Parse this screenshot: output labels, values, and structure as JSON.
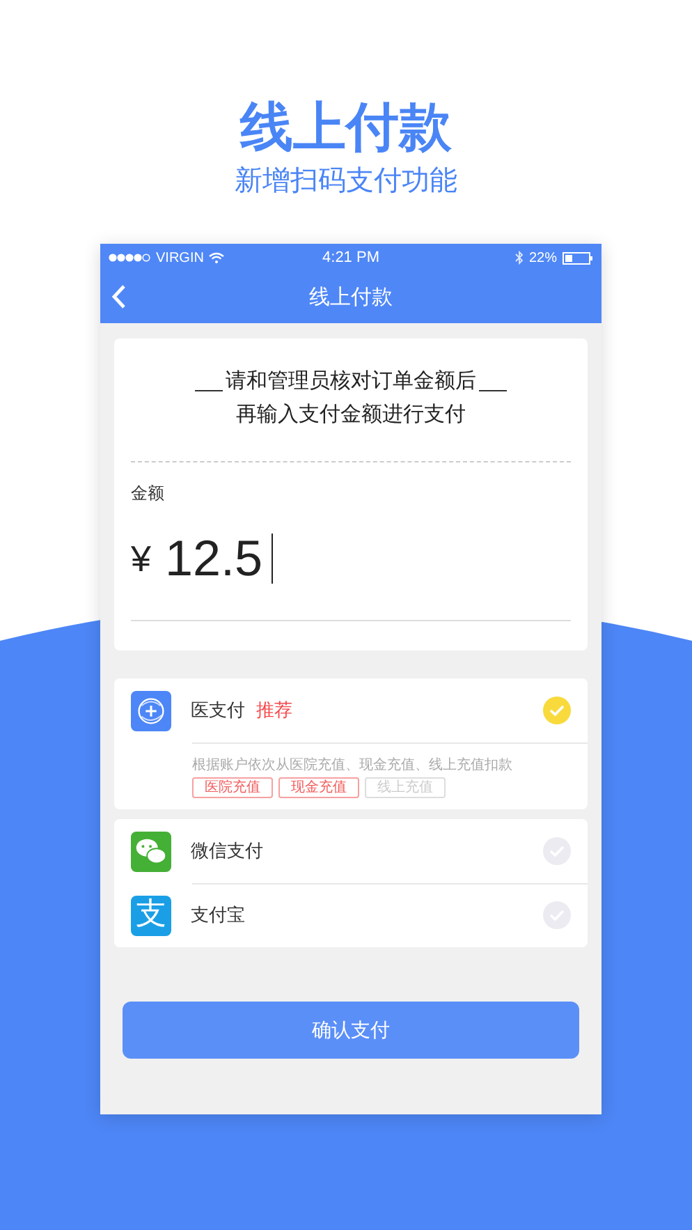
{
  "headline": {
    "title": "线上付款",
    "subtitle": "新增扫码支付功能"
  },
  "status_bar": {
    "carrier": "VIRGIN",
    "time": "4:21 PM",
    "battery": "22%"
  },
  "nav": {
    "title": "线上付款"
  },
  "notice": {
    "lines": [
      "请和管理员核对订单金额后",
      "再输入支付金额进行支付"
    ]
  },
  "amount": {
    "label": "金额",
    "currency": "¥",
    "value": "12.5"
  },
  "payment_groups": [
    {
      "methods": [
        {
          "kind": "medical",
          "name": "医支付",
          "badge": "推荐",
          "selected": true,
          "description": "根据账户依次从医院充值、现金充值、线上充值扣款",
          "tags": [
            {
              "label": "医院充值",
              "active": true
            },
            {
              "label": "现金充值",
              "active": true
            },
            {
              "label": "线上充值",
              "active": false
            }
          ]
        }
      ]
    },
    {
      "methods": [
        {
          "kind": "wechat",
          "name": "微信支付",
          "selected": false
        },
        {
          "kind": "alipay",
          "name": "支付宝",
          "logo_text": "支",
          "selected": false
        }
      ]
    }
  ],
  "confirm_button": "确认支付"
}
